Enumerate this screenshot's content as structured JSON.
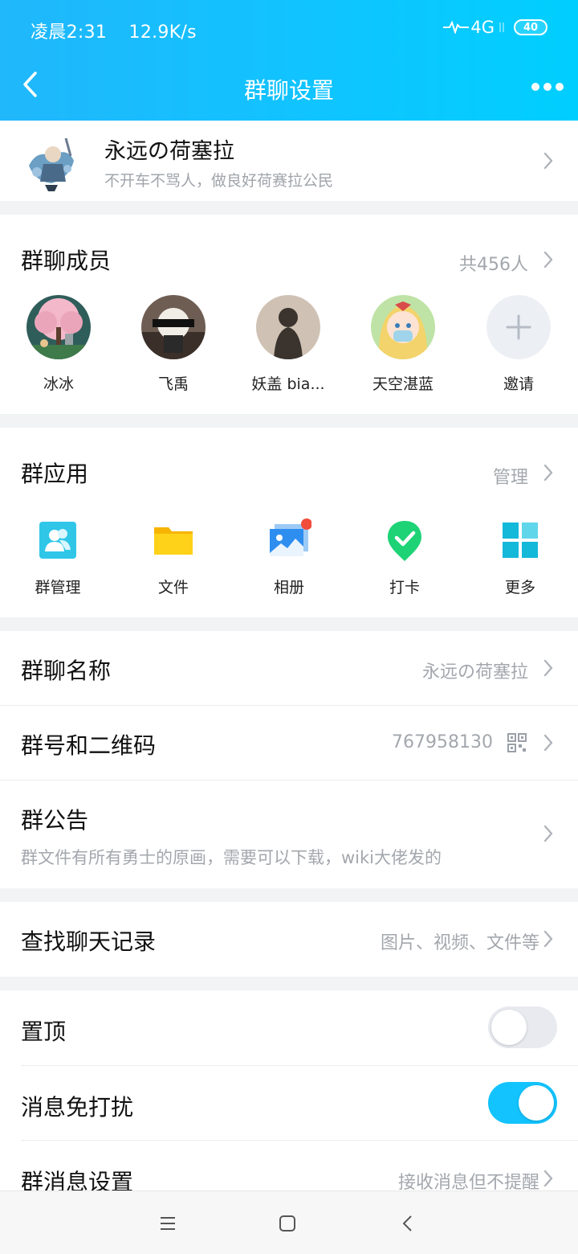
{
  "status_bar": {
    "time": "凌晨2:31",
    "speed": "12.9K/s",
    "network": "4G",
    "battery": "40"
  },
  "nav": {
    "title": "群聊设置"
  },
  "group": {
    "name": "永远の荷塞拉",
    "description": "不开车不骂人，做良好荷赛拉公民"
  },
  "members": {
    "title": "群聊成员",
    "count": "共456人",
    "list": [
      {
        "name": "冰冰"
      },
      {
        "name": "飞禹"
      },
      {
        "name": "妖盖 bia..."
      },
      {
        "name": "天空湛蓝"
      }
    ],
    "invite": "邀请"
  },
  "apps": {
    "title": "群应用",
    "manage": "管理",
    "items": [
      {
        "label": "群管理",
        "icon": "group-manage-icon"
      },
      {
        "label": "文件",
        "icon": "folder-icon"
      },
      {
        "label": "相册",
        "icon": "album-icon"
      },
      {
        "label": "打卡",
        "icon": "checkin-icon"
      },
      {
        "label": "更多",
        "icon": "grid-icon"
      }
    ]
  },
  "settings": {
    "group_name": {
      "label": "群聊名称",
      "value": "永远の荷塞拉"
    },
    "group_id": {
      "label": "群号和二维码",
      "value": "767958130"
    },
    "announcement": {
      "label": "群公告",
      "value": "群文件有所有勇士的原画，需要可以下载，wiki大佬发的"
    },
    "search": {
      "label": "查找聊天记录",
      "value": "图片、视频、文件等"
    },
    "pin": {
      "label": "置顶",
      "on": false
    },
    "mute": {
      "label": "消息免打扰",
      "on": true
    },
    "msg_setting": {
      "label": "群消息设置",
      "value": "接收消息但不提醒"
    }
  },
  "colors": {
    "accent": "#12c3fe",
    "toggle_off": "#e8eaef"
  }
}
